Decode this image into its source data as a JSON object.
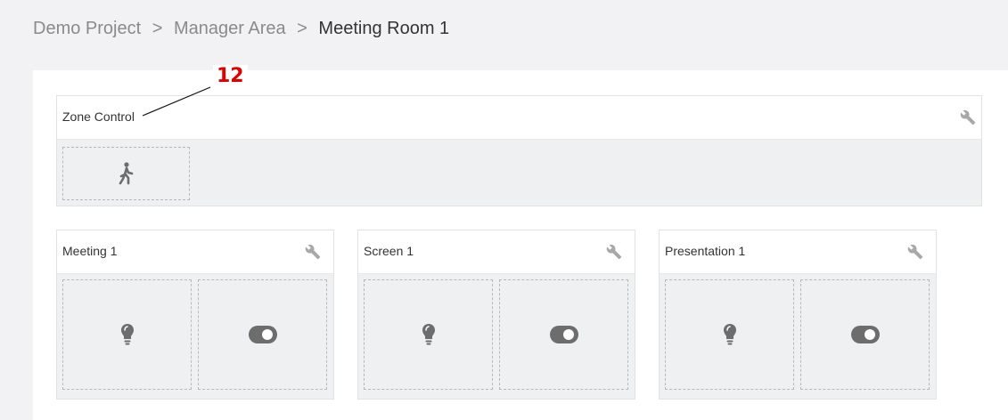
{
  "breadcrumb": {
    "items": [
      "Demo Project",
      "Manager Area"
    ],
    "separator": ">",
    "current": "Meeting Room 1"
  },
  "zone": {
    "title": "Zone Control",
    "tiles": [
      {
        "icon": "walking-person-icon"
      }
    ]
  },
  "cards": [
    {
      "title": "Meeting 1",
      "tiles": [
        {
          "icon": "lightbulb-icon"
        },
        {
          "icon": "toggle-icon"
        }
      ]
    },
    {
      "title": "Screen 1",
      "tiles": [
        {
          "icon": "lightbulb-icon"
        },
        {
          "icon": "toggle-icon"
        }
      ]
    },
    {
      "title": "Presentation 1",
      "tiles": [
        {
          "icon": "lightbulb-icon"
        },
        {
          "icon": "toggle-icon"
        }
      ]
    }
  ],
  "annotation": {
    "number": "12",
    "color": "#e00000"
  },
  "colors": {
    "icon": "#6d6d6d",
    "tile_bg": "#eef0f2",
    "dash": "#b8b8b8"
  }
}
